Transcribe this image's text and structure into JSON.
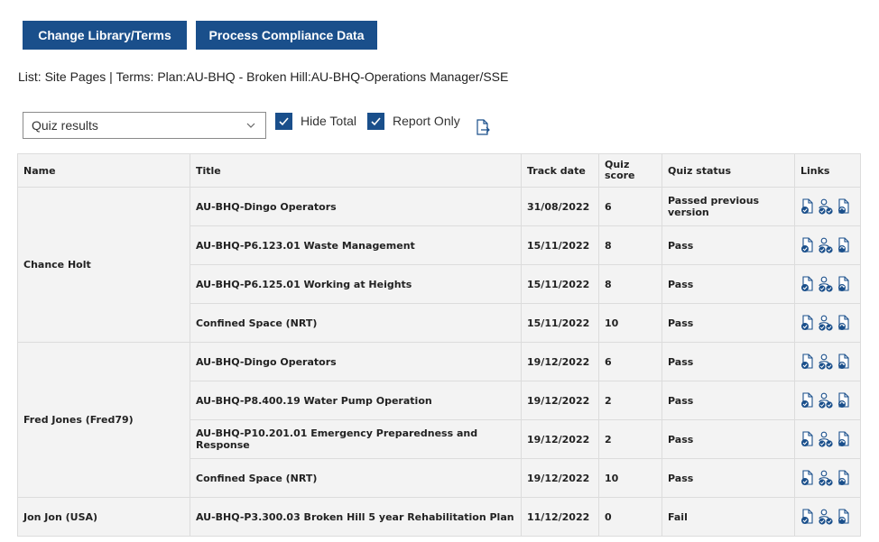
{
  "toolbar": {
    "change_label": "Change Library/Terms",
    "process_label": "Process Compliance Data"
  },
  "list_info": "List: Site Pages | Terms: Plan:AU-BHQ - Broken Hill:AU-BHQ-Operations Manager/SSE",
  "controls": {
    "view_select": "Quiz results",
    "hide_total": {
      "label": "Hide Total",
      "checked": true
    },
    "report_only": {
      "label": "Report Only",
      "checked": true
    },
    "export_icon": "export-file-icon"
  },
  "table": {
    "headers": {
      "name": "Name",
      "title": "Title",
      "track_date": "Track date",
      "quiz_score": "Quiz score",
      "quiz_status": "Quiz status",
      "links": "Links"
    },
    "link_icons": [
      "document-check-icon",
      "users-check-icon",
      "document-sync-icon"
    ],
    "groups": [
      {
        "name": "Chance Holt",
        "rows": [
          {
            "title": "AU-BHQ-Dingo Operators",
            "date": "31/08/2022",
            "score": "6",
            "status": "Passed previous version"
          },
          {
            "title": "AU-BHQ-P6.123.01 Waste Management",
            "date": "15/11/2022",
            "score": "8",
            "status": "Pass"
          },
          {
            "title": "AU-BHQ-P6.125.01 Working at Heights",
            "date": "15/11/2022",
            "score": "8",
            "status": "Pass"
          },
          {
            "title": "Confined Space (NRT)",
            "date": "15/11/2022",
            "score": "10",
            "status": "Pass"
          }
        ]
      },
      {
        "name": "Fred Jones (Fred79)",
        "rows": [
          {
            "title": "AU-BHQ-Dingo Operators",
            "date": "19/12/2022",
            "score": "6",
            "status": "Pass"
          },
          {
            "title": "AU-BHQ-P8.400.19 Water Pump Operation",
            "date": "19/12/2022",
            "score": "2",
            "status": "Pass"
          },
          {
            "title": "AU-BHQ-P10.201.01 Emergency Preparedness and Response",
            "date": "19/12/2022",
            "score": "2",
            "status": "Pass"
          },
          {
            "title": "Confined Space (NRT)",
            "date": "19/12/2022",
            "score": "10",
            "status": "Pass"
          }
        ]
      },
      {
        "name": "Jon Jon (USA)",
        "rows": [
          {
            "title": "AU-BHQ-P3.300.03 Broken Hill 5 year Rehabilitation Plan",
            "date": "11/12/2022",
            "score": "0",
            "status": "Fail"
          }
        ]
      }
    ]
  },
  "colors": {
    "primary": "#1a4f8b",
    "header_bg": "#f3f3f3",
    "border": "#dcdcdc"
  }
}
